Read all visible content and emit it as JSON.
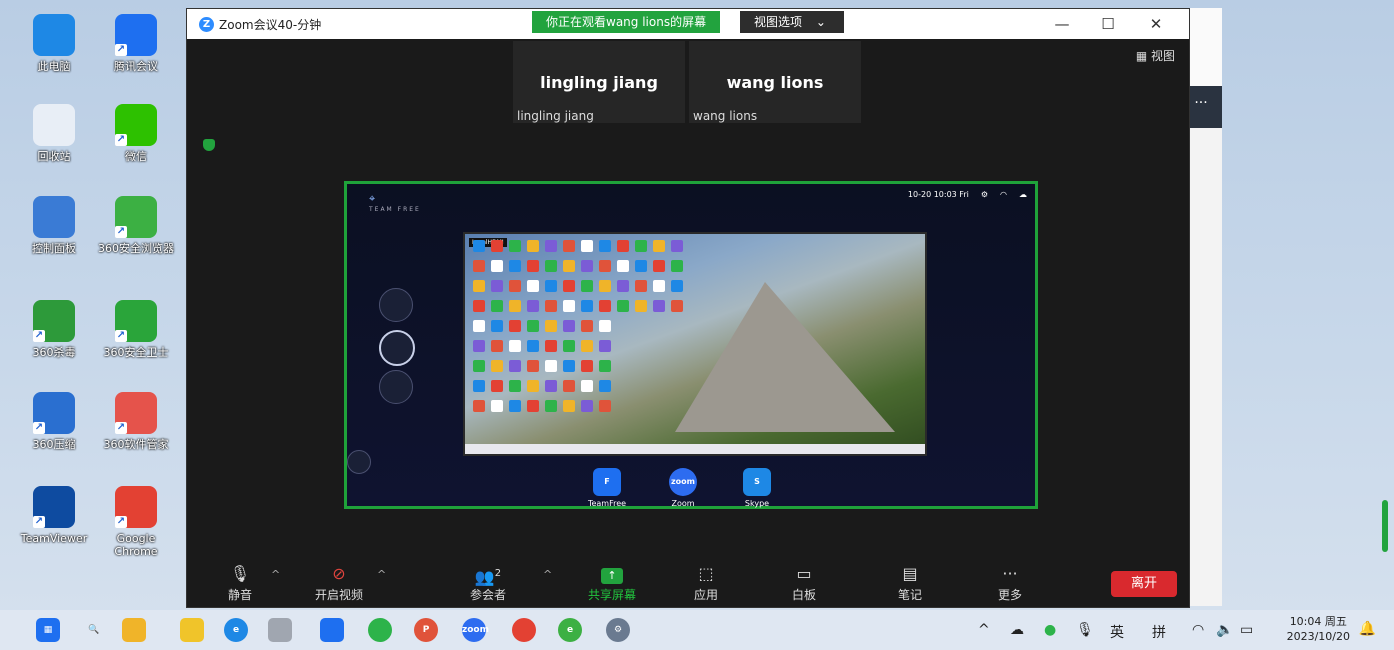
{
  "desktop_icons": [
    {
      "label": "此电脑",
      "icon": "monitor-icon",
      "color": "#1e88e5"
    },
    {
      "label": "腾讯会议",
      "icon": "tencent-meeting-icon",
      "color": "#1e6ff0"
    },
    {
      "label": "回收站",
      "icon": "recycle-bin-icon",
      "color": "#e8eef6"
    },
    {
      "label": "微信",
      "icon": "wechat-icon",
      "color": "#2dc100"
    },
    {
      "label": "控制面板",
      "icon": "control-panel-icon",
      "color": "#3a7bd5"
    },
    {
      "label": "360安全浏览器",
      "icon": "360-browser-icon",
      "color": "#3cb043"
    },
    {
      "label": "360杀毒",
      "icon": "360-antivirus-icon",
      "color": "#2d9a3a"
    },
    {
      "label": "360安全卫士",
      "icon": "360-guard-icon",
      "color": "#2aa53a"
    },
    {
      "label": "360压缩",
      "icon": "360-zip-icon",
      "color": "#2a6fd0"
    },
    {
      "label": "360软件管家",
      "icon": "360-soft-icon",
      "color": "#e5534b"
    },
    {
      "label": "TeamViewer",
      "icon": "teamviewer-icon",
      "color": "#0e4ba0"
    },
    {
      "label": "Google Chrome",
      "icon": "chrome-icon",
      "color": "#e34133"
    }
  ],
  "zoom": {
    "title": "Zoom会议40-分钟",
    "banner": "你正在观看wang lions的屏幕",
    "view_options": "视图选项",
    "view_button": "视图",
    "participants": [
      {
        "display": "lingling jiang",
        "name": "lingling jiang"
      },
      {
        "display": "wang lions",
        "name": "wang lions"
      }
    ],
    "shared": {
      "status": "10-20 10:03 Fri",
      "logo_text": "TEAM FREE",
      "inner_tag": "LocalHDMI",
      "apps": [
        {
          "label": "TeamFree",
          "color": "#1e6ff0",
          "glyph": "F"
        },
        {
          "label": "Zoom",
          "color": "#2d6cf0",
          "glyph": "zoom"
        },
        {
          "label": "Skype",
          "color": "#1e88e5",
          "glyph": "S"
        }
      ]
    },
    "toolbar": {
      "mute": "静音",
      "video": "开启视频",
      "participants": "参会者",
      "participant_count": "2",
      "share": "共享屏幕",
      "apps": "应用",
      "whiteboard": "白板",
      "notes": "笔记",
      "more": "更多",
      "leave": "离开"
    }
  },
  "taskbar": {
    "ime_lang": "英",
    "ime_mode": "拼",
    "time": "10:04 周五",
    "date": "2023/10/20"
  },
  "colors": {
    "accent": "#22a33e",
    "leave": "#d9292e",
    "zoom_blue": "#2d8cff"
  }
}
